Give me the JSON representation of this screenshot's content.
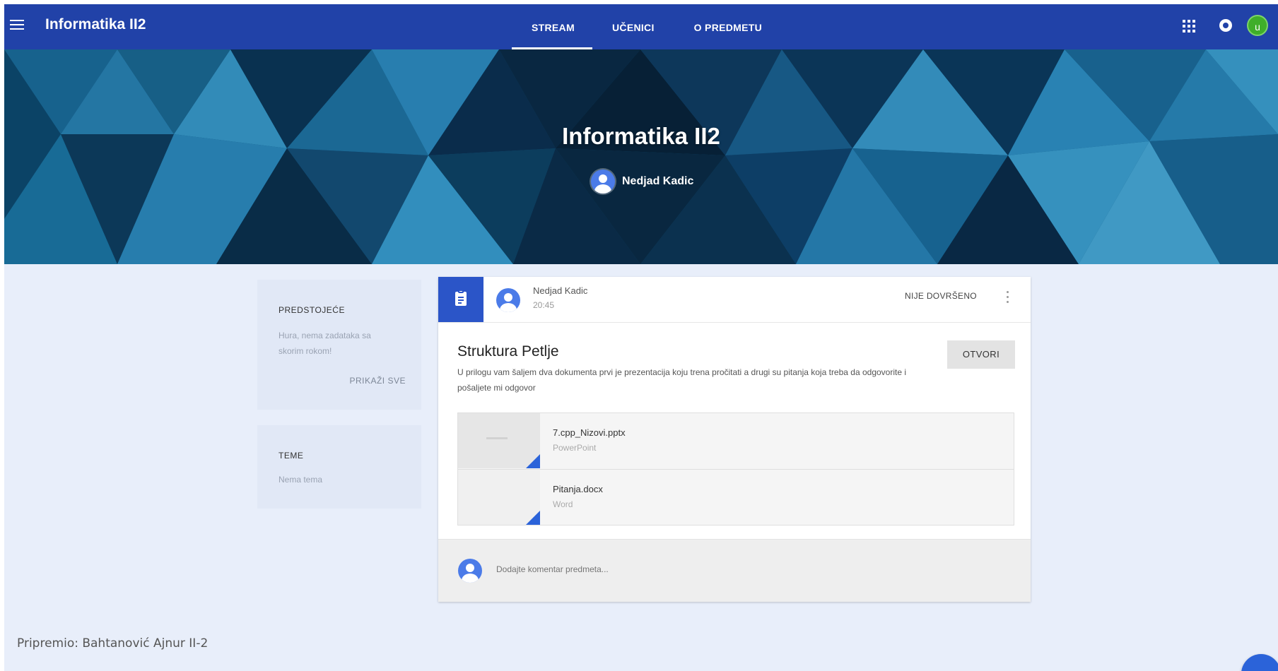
{
  "header": {
    "app_title": "Informatika II2",
    "tabs": [
      {
        "label": "STREAM",
        "active": true
      },
      {
        "label": "UČENICI",
        "active": false
      },
      {
        "label": "O PREDMETU",
        "active": false
      }
    ],
    "user_initial": "u",
    "icons": {
      "menu": "hamburger-icon",
      "apps": "apps-grid-icon",
      "notifications": "notification-icon"
    }
  },
  "banner": {
    "title": "Informatika II2",
    "teacher": "Nedjad Kadic"
  },
  "sidebar": {
    "upcoming": {
      "heading": "PREDSTOJEĆE",
      "text_line1": "Hura, nema zadataka sa",
      "text_line2": "skorim rokom!",
      "link": "PRIKAŽI SVE"
    },
    "topics": {
      "heading": "TEME",
      "text": "Nema tema"
    }
  },
  "post": {
    "author": "Nedjad Kadic",
    "time": "20:45",
    "status": "NIJE DOVRŠENO",
    "title": "Struktura Petlje",
    "description": "U prilogu vam šaljem dva dokumenta prvi je prezentacija koju trena pročitati a drugi su pitanja koja treba da odgovorite i pošaljete mi odgovor",
    "open_button": "OTVORI",
    "attachments": [
      {
        "name": "7.cpp_Nizovi.pptx",
        "type": "PowerPoint"
      },
      {
        "name": "Pitanja.docx",
        "type": "Word"
      }
    ],
    "comment_placeholder": "Dodajte komentar predmeta..."
  },
  "footer_note": "Pripremio: Bahtanović Ajnur II-2",
  "colors": {
    "topbar": "#2142a8",
    "accent": "#2b55c8",
    "page_bg": "#e8eefa",
    "avatar_green": "#3fae2a"
  }
}
